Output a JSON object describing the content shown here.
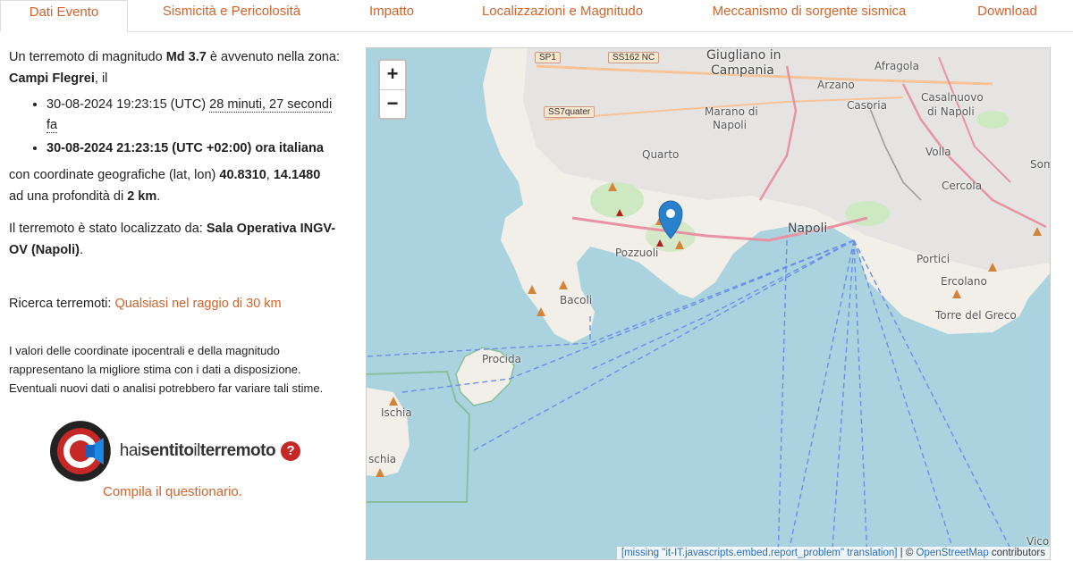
{
  "tabs": [
    {
      "label": "Dati Evento",
      "active": true
    },
    {
      "label": "Sismicità e Pericolosità",
      "active": false
    },
    {
      "label": "Impatto",
      "active": false
    },
    {
      "label": "Localizzazioni e Magnitudo",
      "active": false
    },
    {
      "label": "Meccanismo di sorgente sismica",
      "active": false
    },
    {
      "label": "Download",
      "active": false
    }
  ],
  "event": {
    "intro_pre": "Un terremoto di magnitudo ",
    "magnitude": "Md 3.7",
    "intro_mid": " è avvenuto nella zona: ",
    "zone": "Campi Flegrei",
    "intro_post": ", il",
    "utc_time": "30-08-2024 19:23:15 (UTC) ",
    "time_ago": "28 minuti, 27 secondi fa",
    "local_time": "30-08-2024 21:23:15 (UTC +02:00) ora italiana",
    "coords_pre": "con coordinate geografiche (lat, lon) ",
    "lat": "40.8310",
    "sep": ", ",
    "lon": "14.1480",
    "depth_pre": "ad una profondità di ",
    "depth": "2 km",
    "depth_post": ".",
    "located_pre": "Il terremoto è stato localizzato da: ",
    "located_by": "Sala Operativa INGV-OV (Napoli)",
    "located_post": "."
  },
  "search": {
    "label": "Ricerca terremoti: ",
    "link": "Qualsiasi nel raggio di 30 km"
  },
  "note": "I valori delle coordinate ipocentrali e della magnitudo rappresentano la migliore stima con i dati a disposizione. Eventuali nuovi dati o analisi potrebbero far variare tali stime.",
  "hst": {
    "brand_a": "hai",
    "brand_b": "sentito",
    "brand_c": "il",
    "brand_d": "terremoto",
    "help": "?",
    "cta": "Compila il questionario."
  },
  "map": {
    "zoom_in": "+",
    "zoom_out": "−",
    "attribution_missing": "[missing \"it-IT.javascripts.embed.report_problem\" translation]",
    "attribution_sep": " | © ",
    "attribution_osm": "OpenStreetMap",
    "attribution_post": " contributors",
    "labels": {
      "giugliano": "Giugliano in",
      "campania": "Campania",
      "afragola": "Afragola",
      "arzano": "Arzano",
      "casalnuovo": "Casalnuovo",
      "dinapoli": "di Napoli",
      "casoria": "Casoria",
      "marano": "Marano di",
      "maranonapoli": "Napoli",
      "quarto": "Quarto",
      "volla": "Volla",
      "cercola": "Cercola",
      "somma": "Somm",
      "napoli": "Napoli",
      "pozzuoli": "Pozzuoli",
      "bacoli": "Bacoli",
      "portici": "Portici",
      "ercolano": "Ercolano",
      "torre": "Torre del Greco",
      "procida": "Procida",
      "ischia": "Ischia",
      "ischia2": "schia",
      "vico": "Vico E",
      "sp1": "SP1",
      "ss162": "SS162 NC",
      "ss7": "SS7quater"
    },
    "colors": {
      "sea": "#aad3df",
      "land": "#f2efe9",
      "urban": "#e0dfdf",
      "road": "#e892a2",
      "marker": "#2a81cb"
    }
  }
}
